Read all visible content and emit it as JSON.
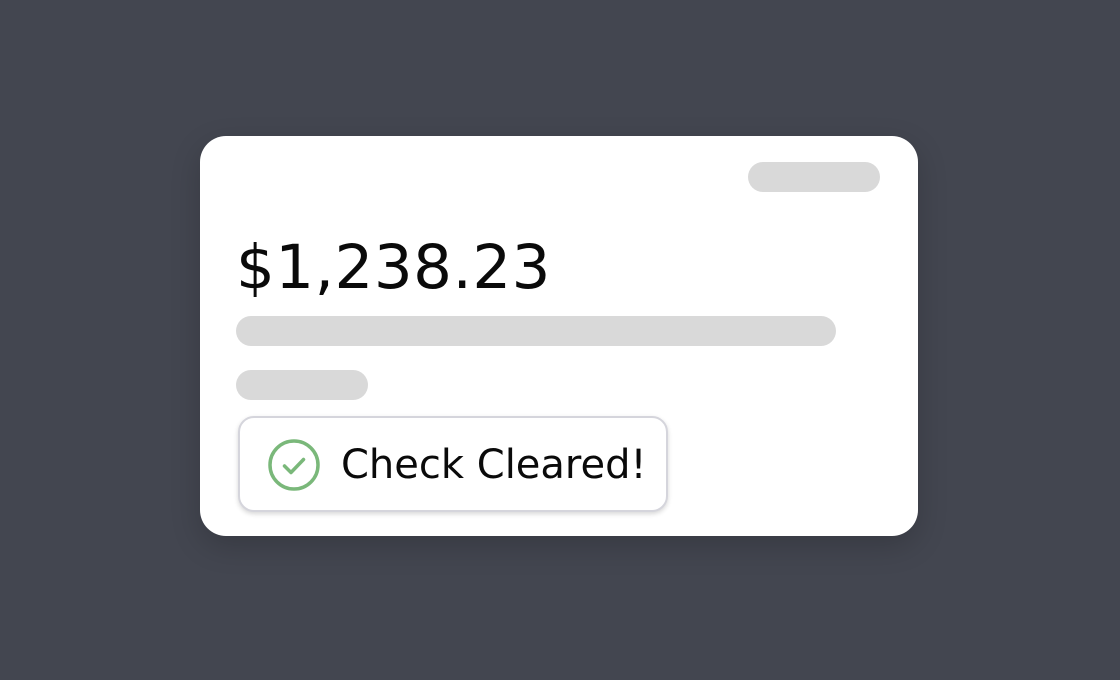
{
  "card": {
    "amount": "$1,238.23"
  },
  "toast": {
    "message": "Check Cleared!",
    "icon": "check-circle-icon"
  },
  "colors": {
    "background": "#434650",
    "card": "#ffffff",
    "skeleton": "#d9d9d9",
    "success": "#7ab87a",
    "text": "#0a0a0a"
  }
}
